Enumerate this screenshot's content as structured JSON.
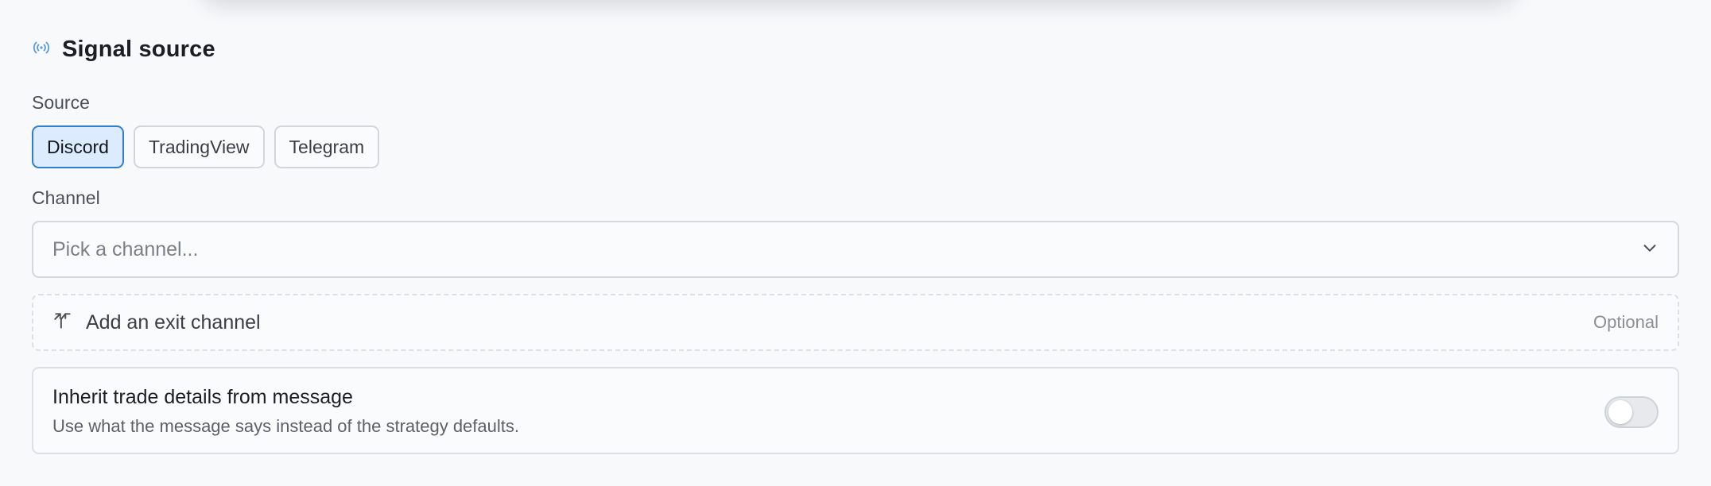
{
  "section": {
    "title": "Signal source",
    "icon": "broadcast-icon"
  },
  "source": {
    "label": "Source",
    "options": [
      "Discord",
      "TradingView",
      "Telegram"
    ],
    "selected": "Discord"
  },
  "channel": {
    "label": "Channel",
    "placeholder": "Pick a channel...",
    "icon": "chevron-down-icon"
  },
  "exit_channel": {
    "label": "Add an exit channel",
    "optional_label": "Optional",
    "icon": "split-arrow-icon"
  },
  "inherit": {
    "title": "Inherit trade details from message",
    "description": "Use what the message says instead of the strategy defaults.",
    "enabled": false
  },
  "colors": {
    "accent": "#2f7fd0",
    "selected_bg": "#dcebfd",
    "icon_accent": "#5b9bd5"
  }
}
